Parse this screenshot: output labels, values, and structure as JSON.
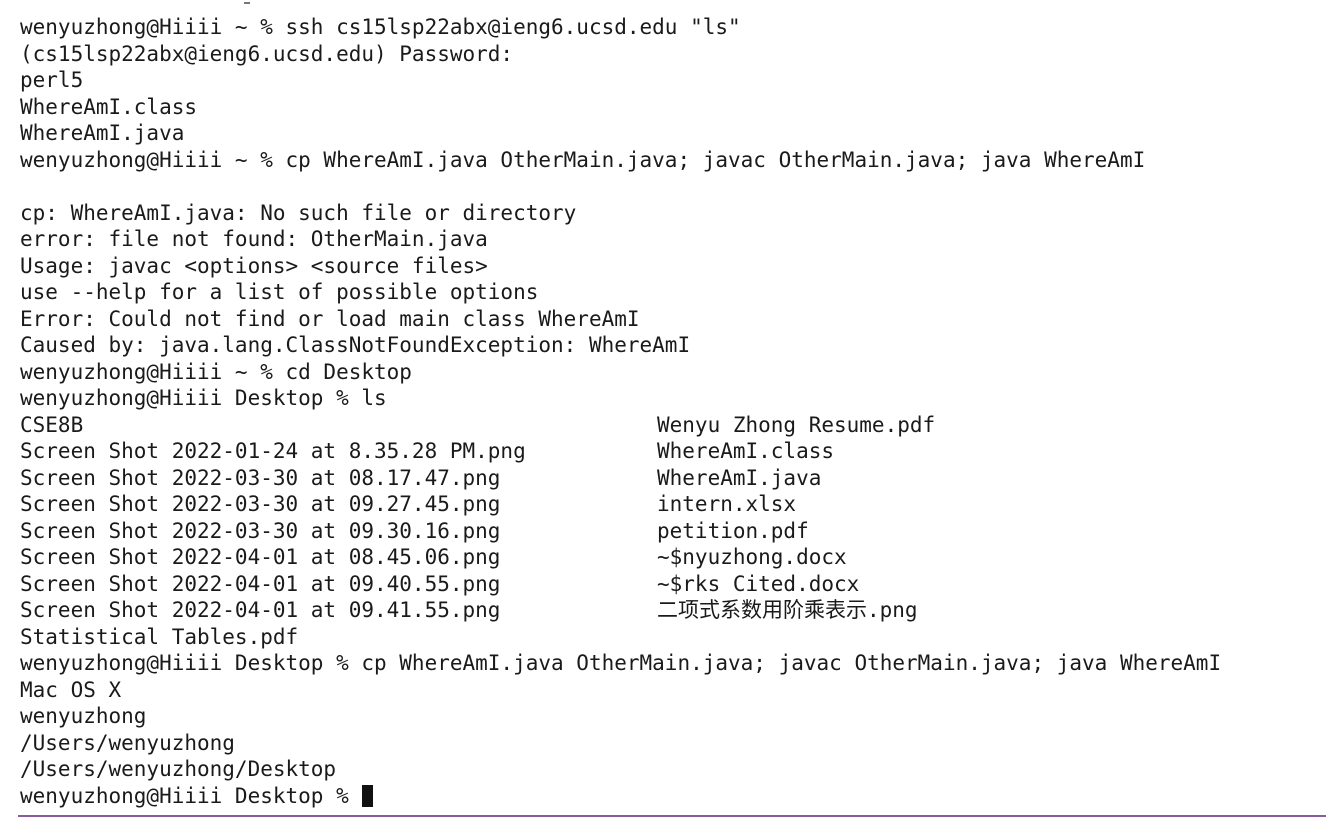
{
  "terminal": {
    "lines": [
      "wenyuzhong@Hiiii ~ % ssh cs15lsp22abx@ieng6.ucsd.edu \"ls\"",
      "(cs15lsp22abx@ieng6.ucsd.edu) Password:",
      "perl5",
      "WhereAmI.class",
      "WhereAmI.java",
      "wenyuzhong@Hiiii ~ % cp WhereAmI.java OtherMain.java; javac OtherMain.java; java WhereAmI",
      "",
      "cp: WhereAmI.java: No such file or directory",
      "error: file not found: OtherMain.java",
      "Usage: javac <options> <source files>",
      "use --help for a list of possible options",
      "Error: Could not find or load main class WhereAmI",
      "Caused by: java.lang.ClassNotFoundException: WhereAmI",
      "wenyuzhong@Hiiii ~ % cd Desktop",
      "wenyuzhong@Hiiii Desktop % ls"
    ],
    "ls_listing": [
      {
        "left": "CSE8B",
        "right": "Wenyu Zhong Resume.pdf"
      },
      {
        "left": "Screen Shot 2022-01-24 at 8.35.28 PM.png",
        "right": "WhereAmI.class"
      },
      {
        "left": "Screen Shot 2022-03-30 at 08.17.47.png",
        "right": "WhereAmI.java"
      },
      {
        "left": "Screen Shot 2022-03-30 at 09.27.45.png",
        "right": "intern.xlsx"
      },
      {
        "left": "Screen Shot 2022-03-30 at 09.30.16.png",
        "right": "petition.pdf"
      },
      {
        "left": "Screen Shot 2022-04-01 at 08.45.06.png",
        "right": "~$nyuzhong.docx"
      },
      {
        "left": "Screen Shot 2022-04-01 at 09.40.55.png",
        "right": "~$rks Cited.docx"
      },
      {
        "left": "Screen Shot 2022-04-01 at 09.41.55.png",
        "right": "二项式系数用阶乘表示.png"
      },
      {
        "left": "Statistical Tables.pdf",
        "right": ""
      }
    ],
    "after_lines": [
      "wenyuzhong@Hiiii Desktop % cp WhereAmI.java OtherMain.java; javac OtherMain.java; java WhereAmI",
      "Mac OS X",
      "wenyuzhong",
      "/Users/wenyuzhong",
      "/Users/wenyuzhong/Desktop"
    ],
    "prompt": "wenyuzhong@Hiiii Desktop % "
  },
  "colors": {
    "background": "#ffffff",
    "text": "#1a1a1a",
    "rule": "#8a5a9a"
  }
}
